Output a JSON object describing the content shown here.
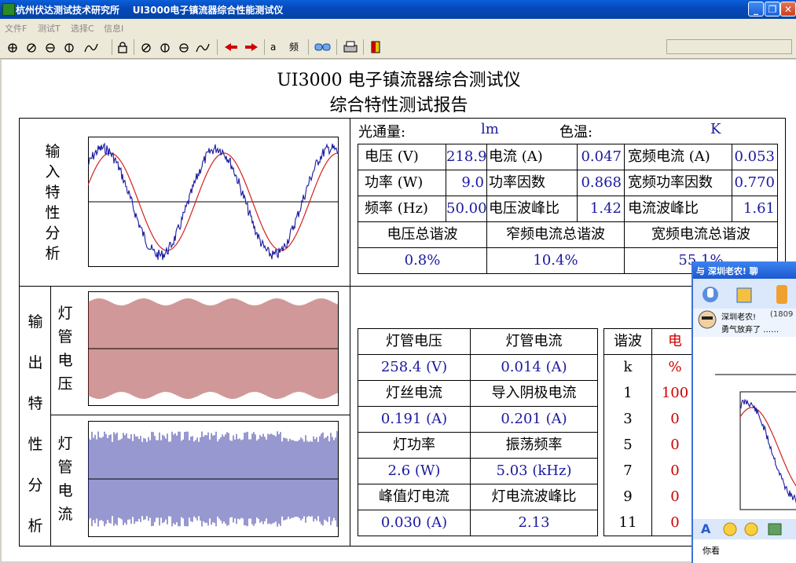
{
  "window": {
    "title": "杭州伏达测试技术研究所    UI3000电子镇流器综合性能测试仪",
    "min": "_",
    "max": "❐",
    "close": "✕"
  },
  "menu": [
    "文件F",
    "测试T",
    "选择C",
    "信息I"
  ],
  "toolbar": {
    "items": [
      "?",
      "?",
      "?",
      "?",
      "?",
      "?",
      "?",
      "?",
      "?",
      "?",
      "?",
      "?",
      "?",
      "?"
    ],
    "labels": [
      "a",
      "频"
    ]
  },
  "report": {
    "title": "UI3000 电子镇流器综合测试仪",
    "subtitle": "综合特性测试报告",
    "luminous_label": "光通量:",
    "luminous_unit": "lm",
    "cct_label": "色温:",
    "cct_unit": "K",
    "input_label": [
      "输",
      "入",
      "特",
      "性",
      "分",
      "析"
    ],
    "output_label": [
      "输",
      "出",
      "特",
      "性",
      "分",
      "析"
    ],
    "lamp_voltage_label": [
      "灯",
      "管",
      "电",
      "压"
    ],
    "lamp_current_label": [
      "灯",
      "管",
      "电",
      "流"
    ],
    "input_params": [
      {
        "l1": "电压 (V)",
        "v1": "218.9",
        "l2": "电流 (A)",
        "v2": "0.047",
        "l3": "宽频电流 (A)",
        "v3": "0.053"
      },
      {
        "l1": "功率 (W)",
        "v1": "9.0",
        "l2": "功率因数",
        "v2": "0.868",
        "l3": "宽频功率因数",
        "v3": "0.770"
      },
      {
        "l1": "频率 (Hz)",
        "v1": "50.00",
        "l2": "电压波峰比",
        "v2": "1.42",
        "l3": "电流波峰比",
        "v3": "1.61"
      }
    ],
    "thd_headers": [
      "电压总谐波",
      "窄频电流总谐波",
      "宽频电流总谐波"
    ],
    "thd_values": [
      "0.8%",
      "10.4%",
      "55.1%"
    ],
    "output_params": [
      [
        "灯管电压",
        "灯管电流"
      ],
      [
        "258.4 (V)",
        "0.014 (A)"
      ],
      [
        "灯丝电流",
        "导入阴极电流"
      ],
      [
        "0.191 (A)",
        "0.201 (A)"
      ],
      [
        "灯功率",
        "振荡频率"
      ],
      [
        "2.6 (W)",
        "5.03 (kHz)"
      ],
      [
        "峰值灯电流",
        "灯电流波峰比"
      ],
      [
        "0.030 (A)",
        "2.13"
      ]
    ],
    "harmonic_header": "谐波",
    "harmonic_header2": "电",
    "harmonic_orders": [
      "k",
      "1",
      "3",
      "5",
      "7",
      "9",
      "11"
    ],
    "harmonic_values": [
      "%",
      "100",
      "0",
      "0",
      "0",
      "0",
      "0"
    ]
  },
  "qq": {
    "title": "与  深圳老农!  聊",
    "contact": "深圳老农!",
    "contact_id": "(1809",
    "status": "勇气放弃了 ……",
    "input_text": "你看"
  },
  "colors": {
    "wave_voltage": "#d42020",
    "wave_current": "#1a1aa0",
    "lamp_voltage_fill": "#a03030",
    "lamp_current_fill": "#3030a0"
  }
}
